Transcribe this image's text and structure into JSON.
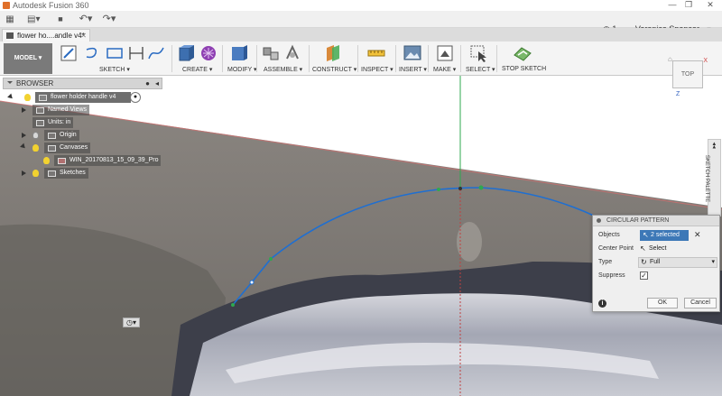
{
  "window": {
    "title": "Autodesk Fusion 360",
    "controls": [
      "—",
      "❐",
      "✕"
    ]
  },
  "qat": {
    "grid": "▦",
    "save": "■",
    "undo": "↶▾",
    "redo": "↷▾"
  },
  "user": {
    "jobs": "1",
    "name": "Veronica Spencer",
    "help": "?▾"
  },
  "tab": {
    "label": "flower ho....andle v4*",
    "close": "✕"
  },
  "ribbon": {
    "workspace": "MODEL ▾",
    "groups": [
      {
        "label": "SKETCH ▾"
      },
      {
        "label": "CREATE ▾"
      },
      {
        "label": "MODIFY ▾"
      },
      {
        "label": "ASSEMBLE ▾"
      },
      {
        "label": "CONSTRUCT ▾"
      },
      {
        "label": "INSPECT ▾"
      },
      {
        "label": "INSERT ▾"
      },
      {
        "label": "MAKE ▾"
      },
      {
        "label": "SELECT ▾"
      },
      {
        "label": "STOP SKETCH"
      }
    ]
  },
  "browser": {
    "header": "BROWSER",
    "root": "flower holder handle v4",
    "items": [
      "Named Views",
      "Units: in",
      "Origin",
      "Canvases",
      "WIN_20170813_15_09_39_Pro",
      "Sketches"
    ]
  },
  "viewcube": {
    "face": "TOP",
    "x": "X",
    "z": "Z"
  },
  "palette_tab": "SKETCH PALETTE",
  "circular_pattern": {
    "title": "CIRCULAR PATTERN",
    "objects_label": "Objects",
    "objects_value": "2 selected",
    "center_label": "Center Point",
    "center_value": "Select",
    "type_label": "Type",
    "type_value": "Full",
    "suppress_label": "Suppress",
    "suppress_checked": true,
    "ok": "OK",
    "cancel": "Cancel"
  },
  "colors": {
    "sketch_curve": "#1f6fd1",
    "green_axis": "#2fa84f",
    "red_axis": "#d06060",
    "panel_select": "#3d78b7"
  }
}
